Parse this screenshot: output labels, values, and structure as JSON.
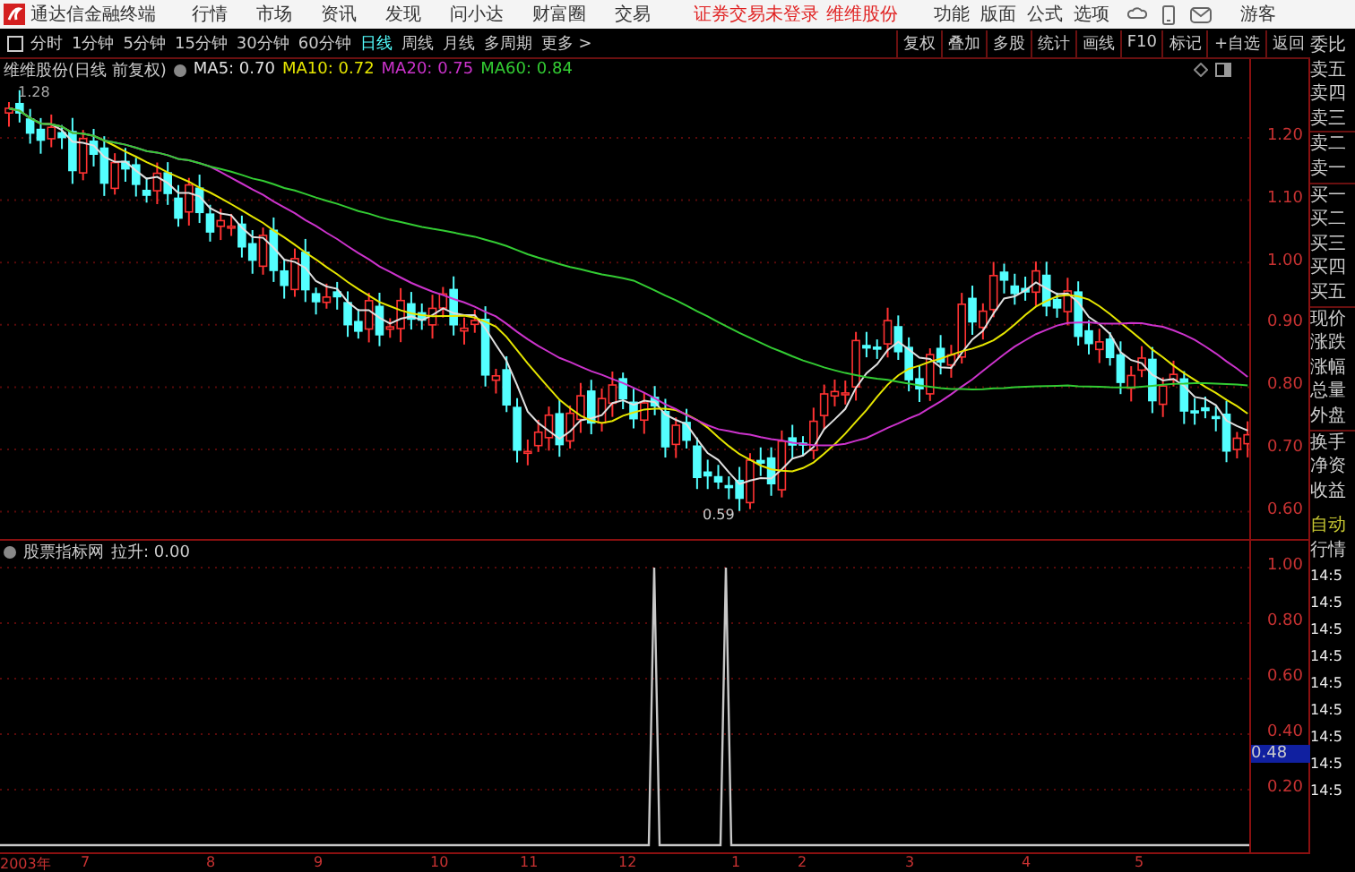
{
  "title_bar": {
    "app_name": "通达信金融终端",
    "menu": [
      "行情",
      "市场",
      "资讯",
      "发现",
      "问小达",
      "财富圈",
      "交易"
    ],
    "login_status": "证券交易未登录",
    "stock_name": "维维股份",
    "tools": [
      "功能",
      "版面",
      "公式",
      "选项"
    ],
    "user": "游客"
  },
  "period_tabs": [
    {
      "label": "分时",
      "selected": false
    },
    {
      "label": "1分钟",
      "selected": false
    },
    {
      "label": "5分钟",
      "selected": false
    },
    {
      "label": "15分钟",
      "selected": false
    },
    {
      "label": "30分钟",
      "selected": false
    },
    {
      "label": "60分钟",
      "selected": false
    },
    {
      "label": "日线",
      "selected": true
    },
    {
      "label": "周线",
      "selected": false
    },
    {
      "label": "月线",
      "selected": false
    },
    {
      "label": "多周期",
      "selected": false
    },
    {
      "label": "更多 >",
      "selected": false
    }
  ],
  "toolbar_buttons": [
    "复权",
    "叠加",
    "多股",
    "统计",
    "画线",
    "F10",
    "标记",
    "+自选",
    "返回"
  ],
  "main_chart": {
    "legend": "维维股份(日线 前复权)",
    "ma": [
      {
        "label": "MA5: 0.70",
        "color": "#e0e0e0"
      },
      {
        "label": "MA10: 0.72",
        "color": "#e6e600"
      },
      {
        "label": "MA20: 0.75",
        "color": "#cc33cc"
      },
      {
        "label": "MA60: 0.84",
        "color": "#33cc33"
      }
    ],
    "high_label": "1.28",
    "low_label": "0.59",
    "y_axis": [
      "1.20",
      "1.10",
      "1.00",
      "0.90",
      "0.80",
      "0.70",
      "0.60"
    ]
  },
  "indicator": {
    "name": "股票指标网",
    "value": "拉升: 0.00",
    "y_axis": [
      "1.00",
      "0.80",
      "0.60",
      "0.40",
      "0.20"
    ],
    "current_value": "0.48"
  },
  "x_axis": [
    "2003年",
    "7",
    "8",
    "9",
    "10",
    "11",
    "12",
    "1",
    "2",
    "3",
    "4",
    "5"
  ],
  "quote_panel": {
    "labels": [
      "委比",
      "卖五",
      "卖四",
      "卖三",
      "卖二",
      "卖一",
      "买一",
      "买二",
      "买三",
      "买四",
      "买五",
      "现价",
      "涨跌",
      "涨幅",
      "总量",
      "外盘",
      "换手",
      "净资",
      "收益"
    ],
    "auto_label": "自动",
    "market_label": "行情",
    "times": [
      "14:5",
      "14:5",
      "14:5",
      "14:5",
      "14:5",
      "14:5",
      "14:5",
      "14:5",
      "14:5"
    ]
  }
}
